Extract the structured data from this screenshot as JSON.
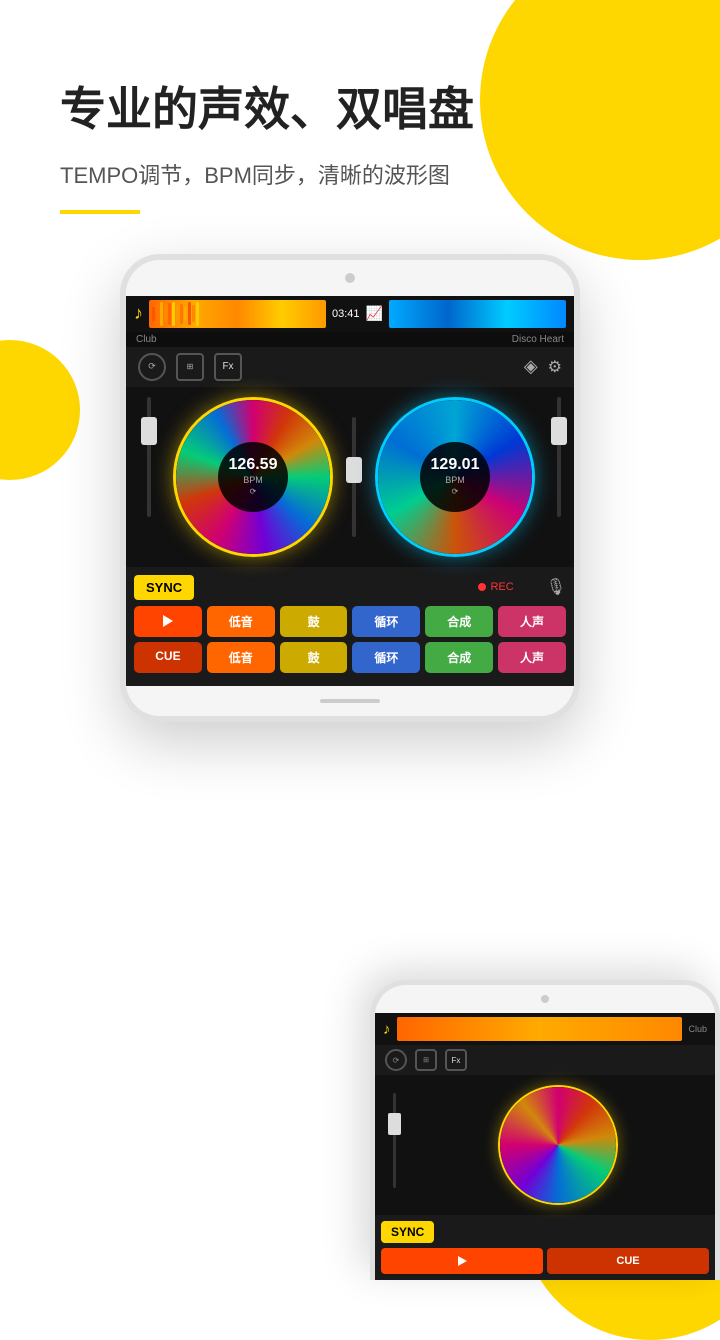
{
  "background": {
    "color": "#ffffff"
  },
  "header": {
    "main_title": "专业的声效、双唱盘",
    "subtitle": "TEMPO调节，BPM同步，清晰的波形图"
  },
  "dj_screen": {
    "track_left": {
      "name": "Club",
      "time": "03:41",
      "bpm": "126.59",
      "bpm_label": "BPM"
    },
    "track_right": {
      "name": "Disco Heart",
      "bpm": "129.01",
      "bpm_label": "BPM"
    },
    "controls": {
      "fx_label": "Fx",
      "sync_label": "SYNC",
      "rec_label": "REC",
      "cue_label": "CUE",
      "play_label": "▶"
    },
    "effect_buttons_row1": [
      {
        "label": "▶",
        "color": "#ff4400"
      },
      {
        "label": "低音",
        "color": "#ff6600"
      },
      {
        "label": "鼓",
        "color": "#ccaa00"
      },
      {
        "label": "循环",
        "color": "#3366cc"
      },
      {
        "label": "合成",
        "color": "#44aa44"
      },
      {
        "label": "人声",
        "color": "#cc3366"
      }
    ],
    "effect_buttons_row2": [
      {
        "label": "CUE",
        "color": "#cc3300"
      },
      {
        "label": "低音",
        "color": "#ff6600"
      },
      {
        "label": "鼓",
        "color": "#ccaa00"
      },
      {
        "label": "循环",
        "color": "#3366cc"
      },
      {
        "label": "合成",
        "color": "#44aa44"
      },
      {
        "label": "人声",
        "color": "#cc3366"
      }
    ]
  },
  "second_phone": {
    "track_name": "Club",
    "sync_label": "SYNC",
    "cue_label": "CUE",
    "play_label": "▶"
  }
}
